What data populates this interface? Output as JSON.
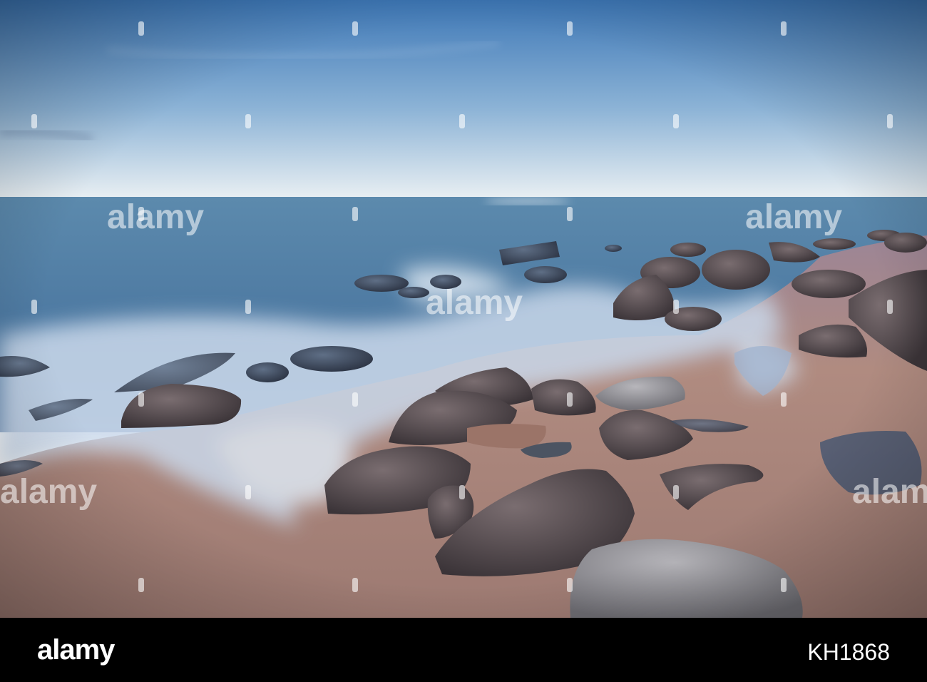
{
  "photo": {
    "watermark_text": "alamy",
    "colors": {
      "sky_top": "#3f7ab8",
      "sky_horizon": "#e6eef3",
      "sea": "#4f7aa3",
      "mist": "#c8d8ea",
      "sand": "#b08a7f",
      "rock": "#5a4f50"
    }
  },
  "footer": {
    "logo": "alamy",
    "image_id": "KH1868",
    "background": "#000000"
  }
}
